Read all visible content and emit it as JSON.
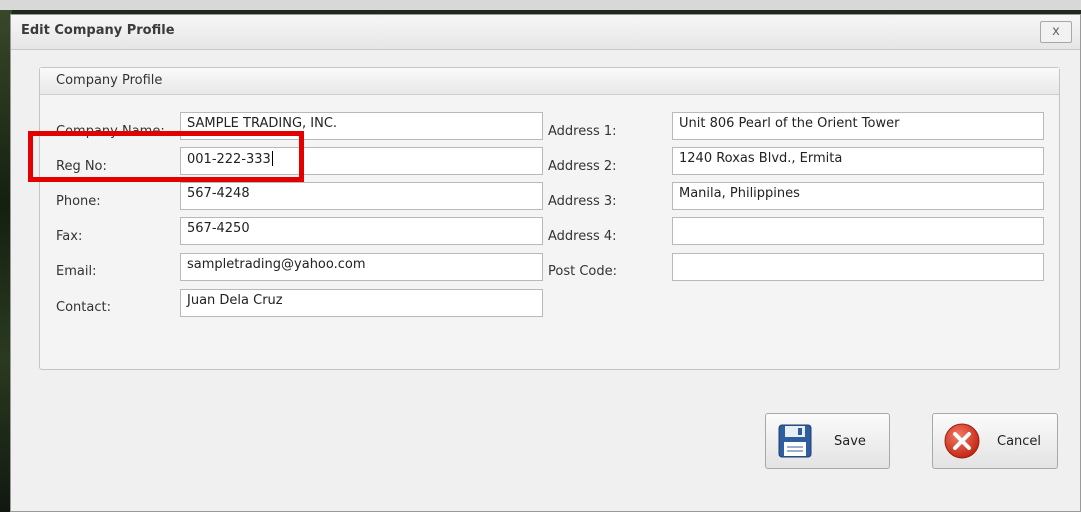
{
  "window": {
    "title": "Edit Company Profile",
    "close_label": "x"
  },
  "group": {
    "title": "Company Profile"
  },
  "fields_left": [
    {
      "label": "Company Name:",
      "value": "SAMPLE TRADING, INC."
    },
    {
      "label": "Reg No:",
      "value": "001-222-333"
    },
    {
      "label": "Phone:",
      "value": "567-4248"
    },
    {
      "label": "Fax:",
      "value": "567-4250"
    },
    {
      "label": "Email:",
      "value": "sampletrading@yahoo.com"
    },
    {
      "label": "Contact:",
      "value": "Juan Dela Cruz"
    }
  ],
  "fields_right": [
    {
      "label": "Address 1:",
      "value": "Unit 806 Pearl of the Orient Tower"
    },
    {
      "label": "Address 2:",
      "value": "1240 Roxas Blvd., Ermita"
    },
    {
      "label": "Address 3:",
      "value": "Manila, Philippines"
    },
    {
      "label": "Address 4:",
      "value": ""
    },
    {
      "label": "Post Code:",
      "value": ""
    }
  ],
  "buttons": {
    "save_label": "Save",
    "cancel_label": "Cancel"
  },
  "colors": {
    "highlight": "#e30000",
    "save_icon": "#2f5e9e",
    "cancel_icon": "#d83a2a"
  }
}
